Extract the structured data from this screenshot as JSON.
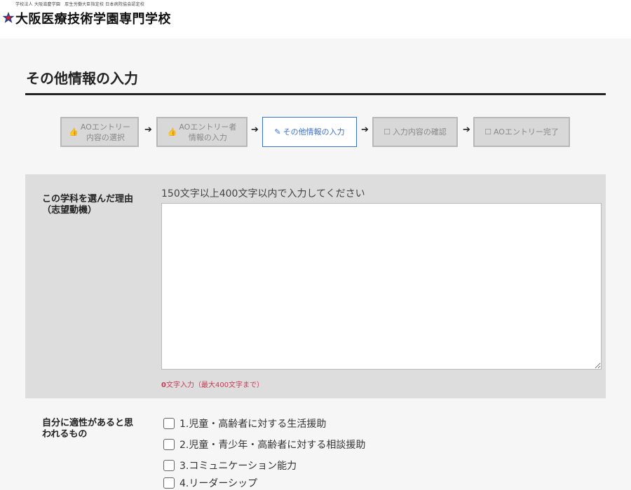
{
  "header": {
    "subtitle": "学校法人 大阪滋慶学園　厚生労働大臣指定校 日本病院協会認定校",
    "school_name": "大阪医療技術学園専門学校",
    "logo_icon": "star-logo-icon",
    "colors": {
      "logo_red": "#d0202e",
      "logo_blue": "#1f3c88"
    }
  },
  "page": {
    "title": "その他情報の入力"
  },
  "steps": [
    {
      "icon": "thumbs-up-icon",
      "glyph": "👍",
      "label": "AOエントリー\n内容の選択",
      "state": "done"
    },
    {
      "icon": "thumbs-up-icon",
      "glyph": "👍",
      "label": "AOエントリー者\n情報の入力",
      "state": "done"
    },
    {
      "icon": "edit-icon",
      "glyph": "✎",
      "label": "その他情報の入力",
      "state": "active"
    },
    {
      "icon": "square-icon",
      "glyph": "☐",
      "label": "入力内容の確認",
      "state": "todo"
    },
    {
      "icon": "square-icon",
      "glyph": "☐",
      "label": "AOエントリー完了",
      "state": "todo"
    }
  ],
  "step_arrow": "➔",
  "reason": {
    "label": "この学科を選んだ理由\n（志望動機）",
    "hint": "150文字以上400文字以内で入力してください",
    "value": "",
    "counter_num": "0",
    "counter_text": "文字入力（最大400文字まで）"
  },
  "aptitude": {
    "label": "自分に適性があると思\nわれるもの",
    "options": [
      {
        "label": "1.児童・高齢者に対する生活援助",
        "checked": false
      },
      {
        "label": "2.児童・青少年・高齢者に対する相談援助",
        "checked": false
      },
      {
        "label": "3.コミュニケーション能力",
        "checked": false
      },
      {
        "label": "4.リーダーシップ",
        "checked": false
      }
    ]
  },
  "colors": {
    "accent": "#3b6fd0",
    "counter": "#c83a54",
    "panel": "#dddddd"
  }
}
